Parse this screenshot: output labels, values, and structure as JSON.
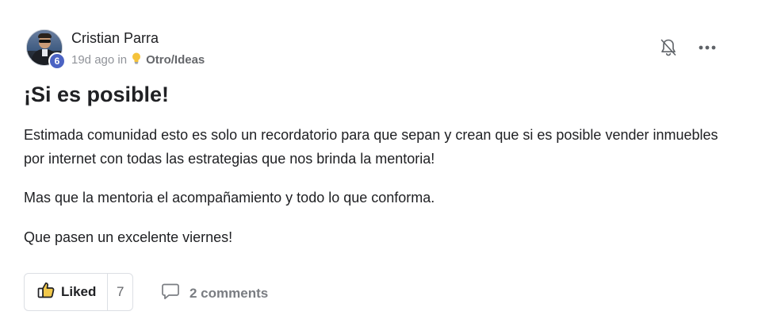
{
  "post": {
    "author": {
      "name": "Cristian Parra",
      "level": "6"
    },
    "meta": {
      "time": "19d ago in",
      "category_icon": "lightbulb-icon",
      "category": "Otro/Ideas"
    },
    "actions": {
      "notify_icon": "bell-off-icon",
      "more_icon": "more-horizontal-icon"
    },
    "title": "¡Si es posible!",
    "body": [
      "Estimada comunidad esto es solo un recordatorio para que sepan y crean que si es posible vender inmuebles por internet con todas las estrategias que nos brinda la mentoria!",
      "Mas que la mentoria el acompañamiento y todo lo que conforma.",
      "Que pasen un excelente viernes!"
    ],
    "footer": {
      "like_label": "Liked",
      "like_count": "7",
      "comments_label": "2 comments"
    }
  },
  "colors": {
    "level_badge": "#4b63c3",
    "text": "#202124",
    "muted": "#909399",
    "like_icon_fill": "#f2c94c"
  }
}
